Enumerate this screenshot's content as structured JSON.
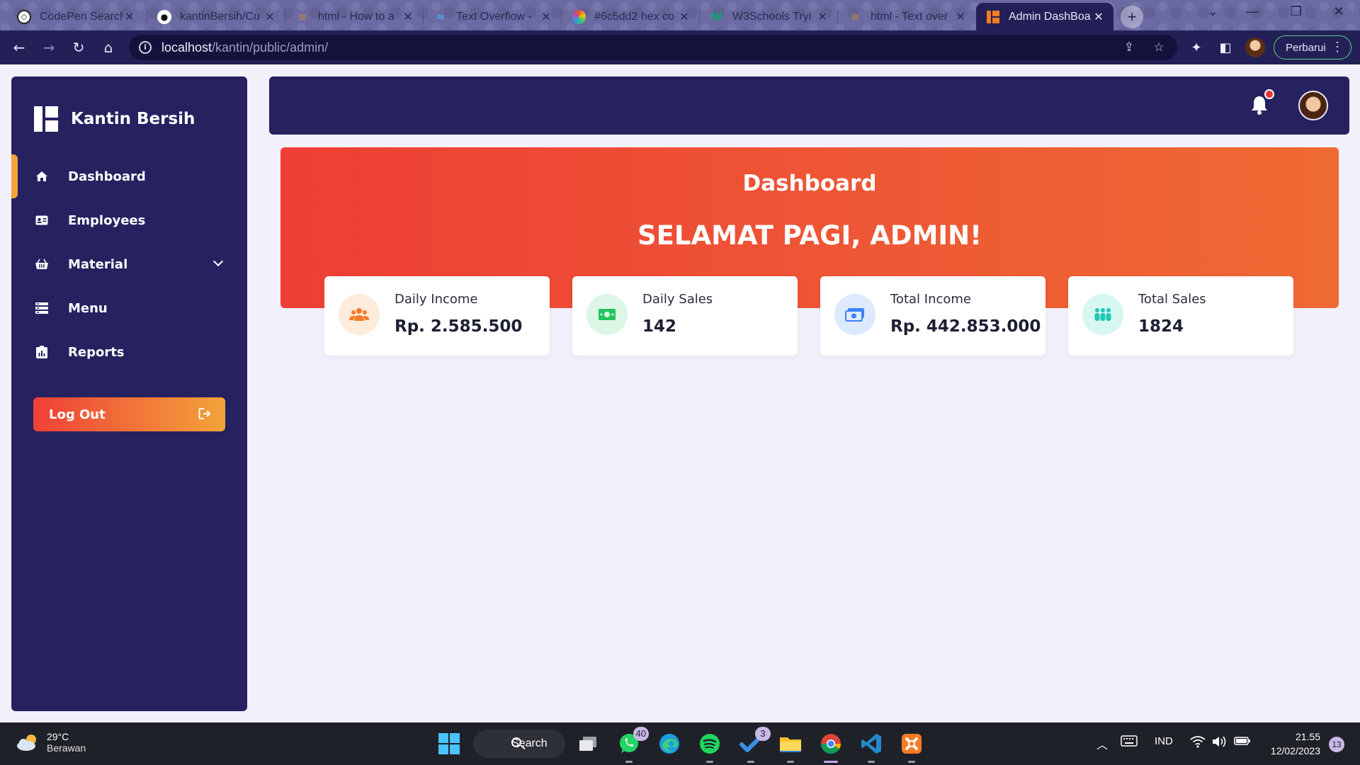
{
  "browser": {
    "tabs": [
      {
        "title": "CodePen Search",
        "icon": "codepen-icon"
      },
      {
        "title": "kantinBersih/Cu",
        "icon": "github-icon"
      },
      {
        "title": "html - How to a",
        "icon": "stackoverflow-icon"
      },
      {
        "title": "Text Overflow -",
        "icon": "tailwind-icon"
      },
      {
        "title": "#6c5dd2 hex co",
        "icon": "color-wheel-icon"
      },
      {
        "title": "W3Schools Tryi",
        "icon": "w3schools-icon"
      },
      {
        "title": "html - Text over",
        "icon": "stackoverflow-icon"
      },
      {
        "title": "Admin DashBoa",
        "icon": "app-logo-icon"
      }
    ],
    "address": {
      "host": "localhost",
      "path": "/kantin/public/admin/"
    },
    "update_button": "Perbarui"
  },
  "app": {
    "brand": "Kantin Bersih",
    "nav": [
      {
        "label": "Dashboard",
        "icon": "home-icon",
        "active": true
      },
      {
        "label": "Employees",
        "icon": "id-card-icon"
      },
      {
        "label": "Material",
        "icon": "basket-icon",
        "has_submenu": true
      },
      {
        "label": "Menu",
        "icon": "list-icon"
      },
      {
        "label": "Reports",
        "icon": "report-icon"
      }
    ],
    "logout_label": "Log Out",
    "notification_has_unread": true
  },
  "hero": {
    "title": "Dashboard",
    "greeting": "SELAMAT PAGI, ADMIN!"
  },
  "cards": [
    {
      "label": "Daily Income",
      "value": "Rp. 2.585.500",
      "icon": "users-icon",
      "color": "#f57b2b",
      "bg": "#fdebdc"
    },
    {
      "label": "Daily Sales",
      "value": "142",
      "icon": "money-bill-icon",
      "color": "#22c55e",
      "bg": "#dcf7e6"
    },
    {
      "label": "Total Income",
      "value": "Rp. 442.853.000",
      "icon": "money-stack-icon",
      "color": "#3b82f6",
      "bg": "#dde9fd"
    },
    {
      "label": "Total Sales",
      "value": "1824",
      "icon": "people-group-icon",
      "color": "#1fc7b3",
      "bg": "#d7f7f1"
    }
  ],
  "colors": {
    "sidebar": "#262260",
    "accent": "#f3a33b",
    "hero_start": "#ee3e35",
    "hero_end": "#ef6a33"
  },
  "taskbar": {
    "weather_temp": "29°C",
    "weather_desc": "Berawan",
    "search_label": "Search",
    "whatsapp_badge": "40",
    "todo_badge": "3",
    "language": "IND",
    "time": "21.55",
    "date": "12/02/2023",
    "notifications": "13"
  }
}
